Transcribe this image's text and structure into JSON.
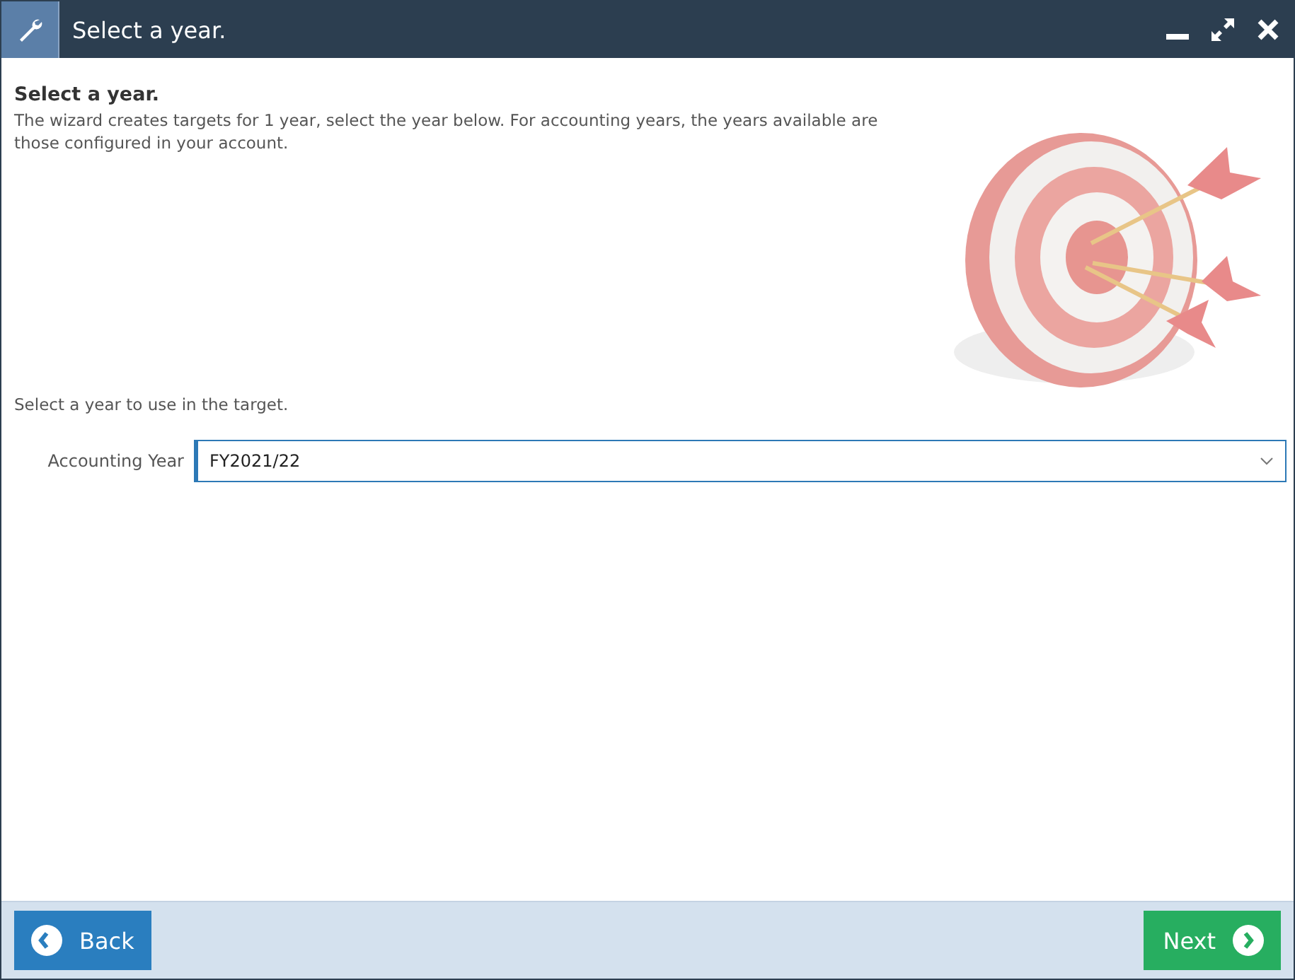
{
  "window": {
    "title": "Select a year."
  },
  "heading": "Select a year.",
  "description": "The wizard creates targets for 1 year, select the year below. For accounting years, the years available are those configured in your account.",
  "prompt": "Select a year to use in the target.",
  "field": {
    "label": "Accounting Year",
    "value": "FY2021/22"
  },
  "buttons": [
    {
      "label": "Back",
      "kind": "back"
    },
    {
      "label": "Next",
      "kind": "next"
    }
  ]
}
